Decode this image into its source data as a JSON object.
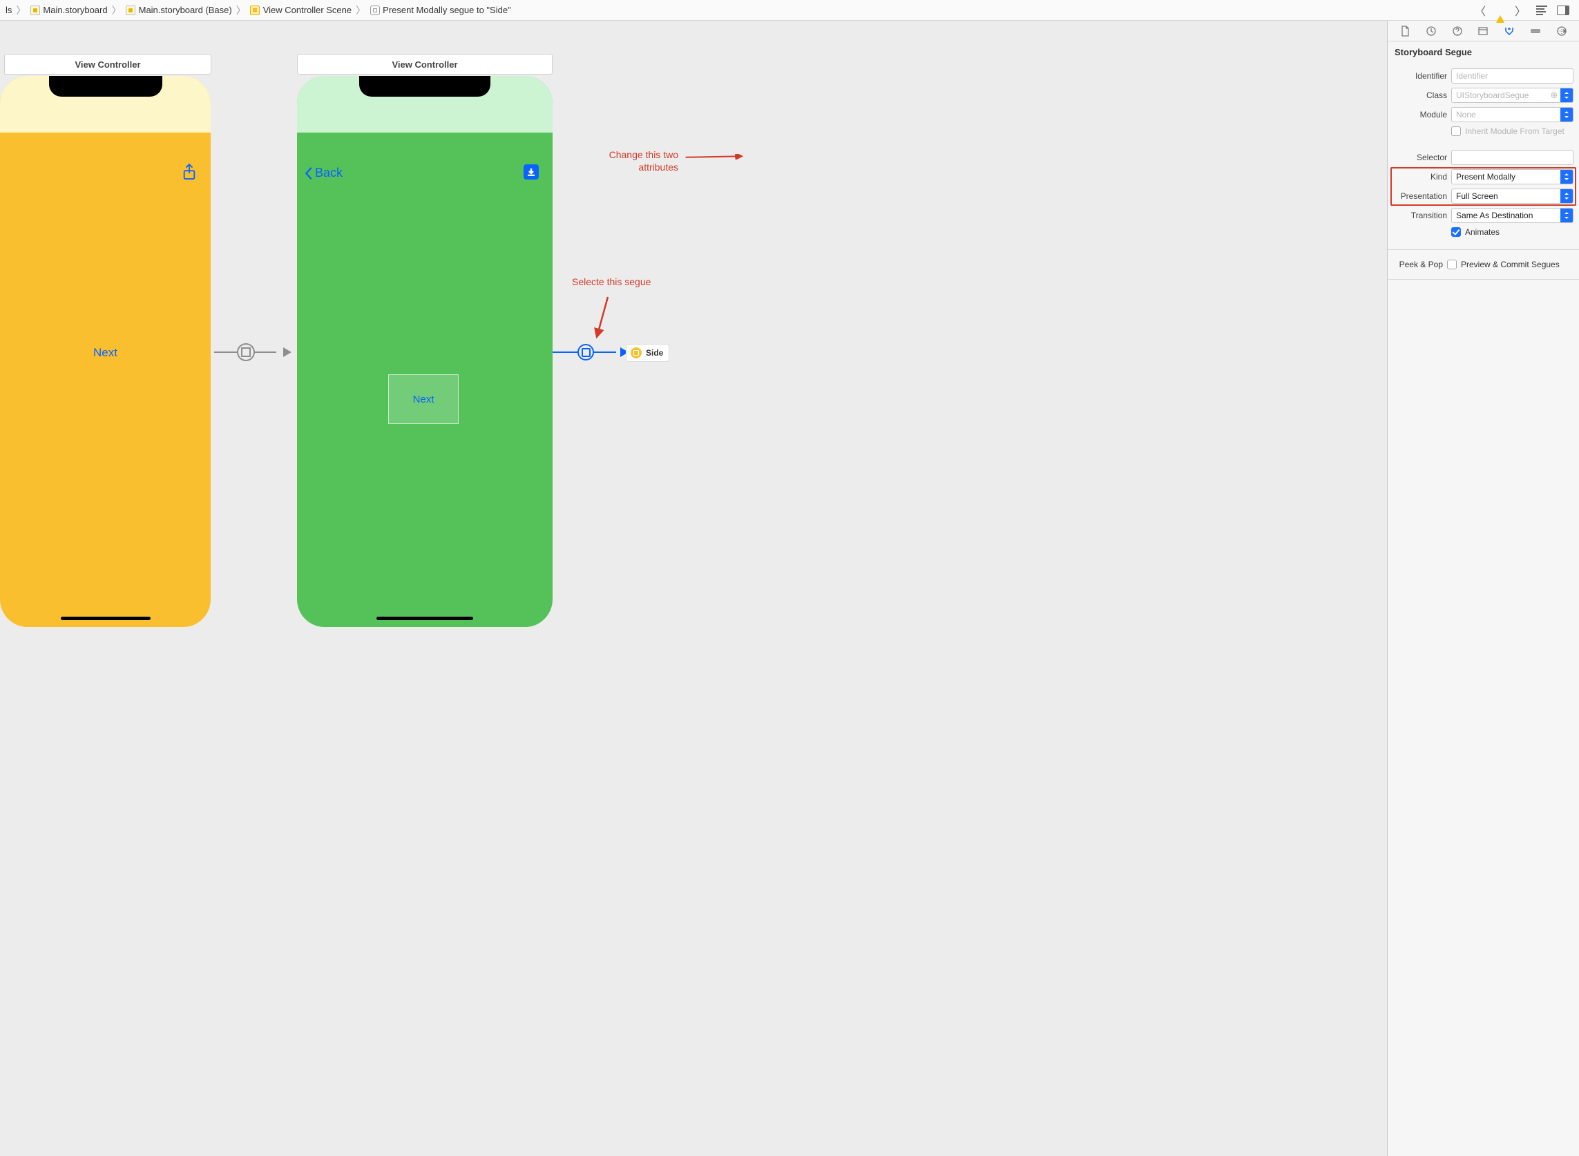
{
  "breadcrumbs": {
    "b0": "ls",
    "b1": "Main.storyboard",
    "b2": "Main.storyboard (Base)",
    "b3": "View Controller Scene",
    "b4": "Present Modally segue to \"Side\""
  },
  "scenes": {
    "vc1_title": "View Controller",
    "vc2_title": "View Controller",
    "vc1_button": "Next",
    "vc2_back": "Back",
    "vc2_container_button": "Next",
    "side_ref": "Side"
  },
  "annotations": {
    "select_segue": "Selecte this segue",
    "change_attrs": "Change this two attributes"
  },
  "inspector": {
    "section": "Storyboard Segue",
    "identifier_label": "Identifier",
    "identifier_placeholder": "Identifier",
    "class_label": "Class",
    "class_placeholder": "UIStoryboardSegue",
    "module_label": "Module",
    "module_value": "None",
    "inherit_label": "Inherit Module From Target",
    "selector_label": "Selector",
    "kind_label": "Kind",
    "kind_value": "Present Modally",
    "presentation_label": "Presentation",
    "presentation_value": "Full Screen",
    "transition_label": "Transition",
    "transition_value": "Same As Destination",
    "animates_label": "Animates",
    "peekpop_label": "Peek & Pop",
    "peekpop_value": "Preview & Commit Segues"
  }
}
